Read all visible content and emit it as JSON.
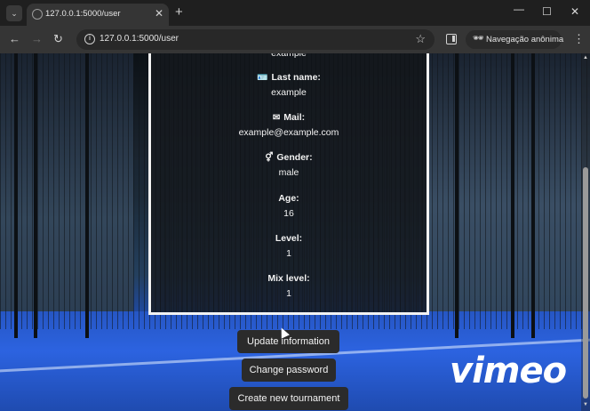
{
  "browser": {
    "tab_title": "127.0.0.1:5000/user",
    "tab_close": "✕",
    "new_tab": "+",
    "url": "127.0.0.1:5000/user",
    "incognito_label": "Navegação anônima",
    "icons": {
      "tab_list": "chevron-down-icon",
      "favicon": "globe-icon",
      "back": "arrow-left-icon",
      "forward": "arrow-right-icon",
      "reload": "reload-icon",
      "site_info": "info-icon",
      "bookmark": "star-icon",
      "side_panel": "side-panel-icon",
      "incognito": "incognito-icon",
      "menu": "kebab-menu-icon",
      "minimize": "minimize-icon",
      "maximize": "maximize-icon",
      "close": "close-icon"
    }
  },
  "profile": {
    "cut_value": "example",
    "fields": [
      {
        "label": "Last name:",
        "value": "example",
        "icon": "id-card-icon"
      },
      {
        "label": "Mail:",
        "value": "example@example.com",
        "icon": "envelope-icon"
      },
      {
        "label": "Gender:",
        "value": "male",
        "icon": "gender-icon"
      },
      {
        "label": "Age:",
        "value": "16",
        "icon": ""
      },
      {
        "label": "Level:",
        "value": "1",
        "icon": ""
      },
      {
        "label": "Mix level:",
        "value": "1",
        "icon": ""
      }
    ]
  },
  "actions": {
    "update": "Update information",
    "password": "Change password",
    "tournament": "Create new tournament"
  },
  "watermark": "vimeo",
  "colors": {
    "card_border": "#f2f2f2",
    "button_bg": "#2b2b2b",
    "court_blue": "#2c63e0"
  }
}
